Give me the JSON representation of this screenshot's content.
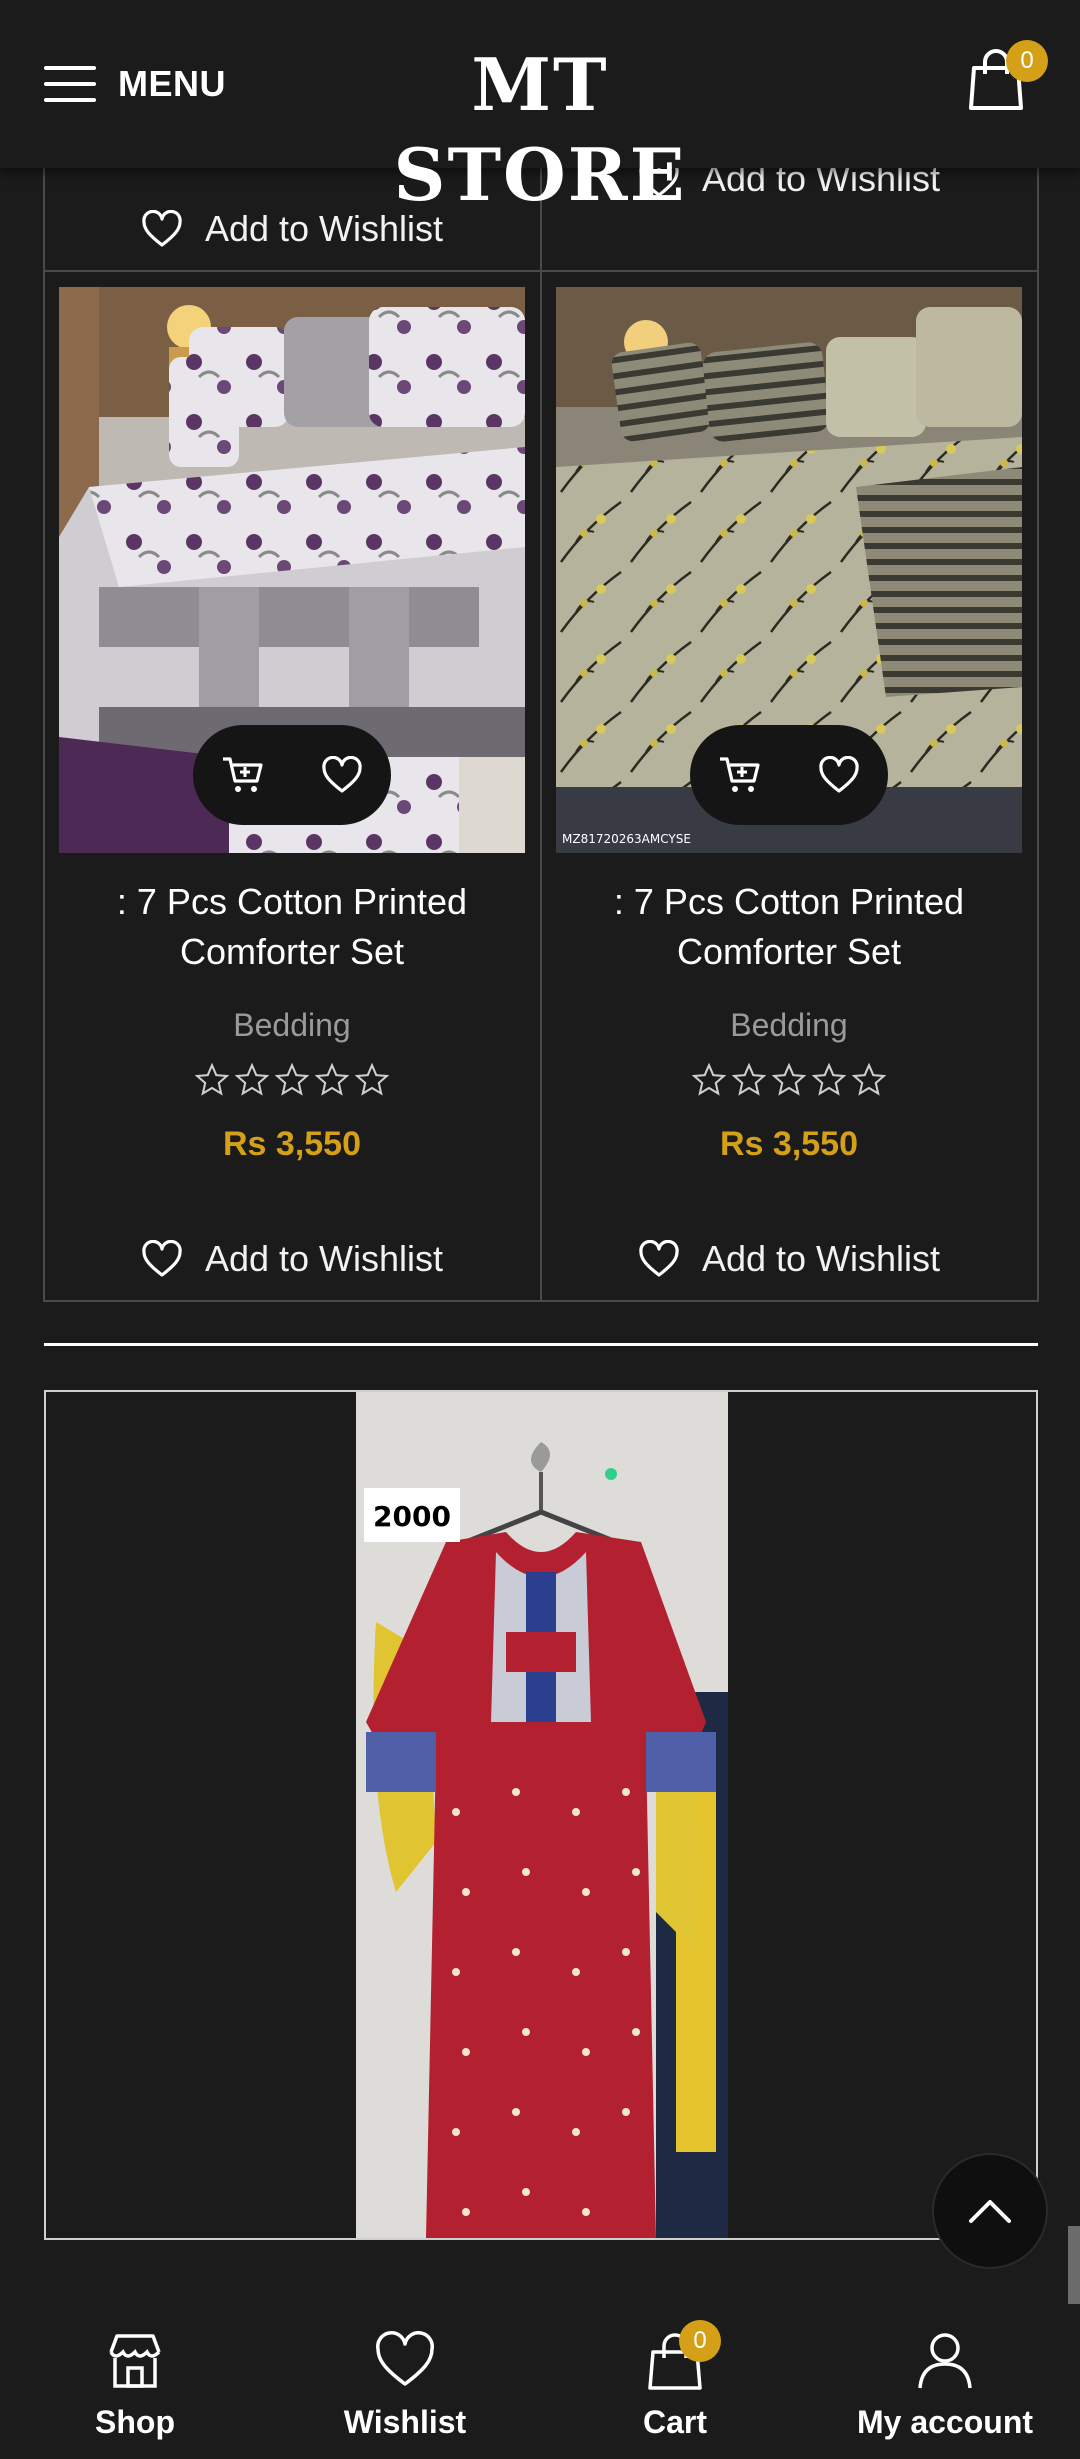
{
  "header": {
    "menu_label": "MENU",
    "logo_text": "MT STORE",
    "cart_count": "0"
  },
  "top_row": {
    "left_wishlist": "Add to Wishlist",
    "right_wishlist": "Add to Wishlist"
  },
  "products": [
    {
      "title": ": 7 Pcs Cotton Printed Comforter Set",
      "category": "Bedding",
      "rating": 0,
      "price": "Rs 3,550",
      "wishlist": "Add to Wishlist"
    },
    {
      "title": ": 7 Pcs Cotton Printed Comforter Set",
      "category": "Bedding",
      "rating": 0,
      "price": "Rs 3,550",
      "wishlist": "Add to Wishlist",
      "image_code": "MZ81720263AMCYSE"
    }
  ],
  "banner": {
    "price_tag": "2000"
  },
  "bottom_nav": {
    "shop": "Shop",
    "wishlist": "Wishlist",
    "cart": "Cart",
    "cart_count": "0",
    "account": "My account"
  },
  "colors": {
    "background": "#1b1b1c",
    "accent": "#d4a017",
    "text": "#ffffff",
    "muted": "#9a9a9a"
  }
}
